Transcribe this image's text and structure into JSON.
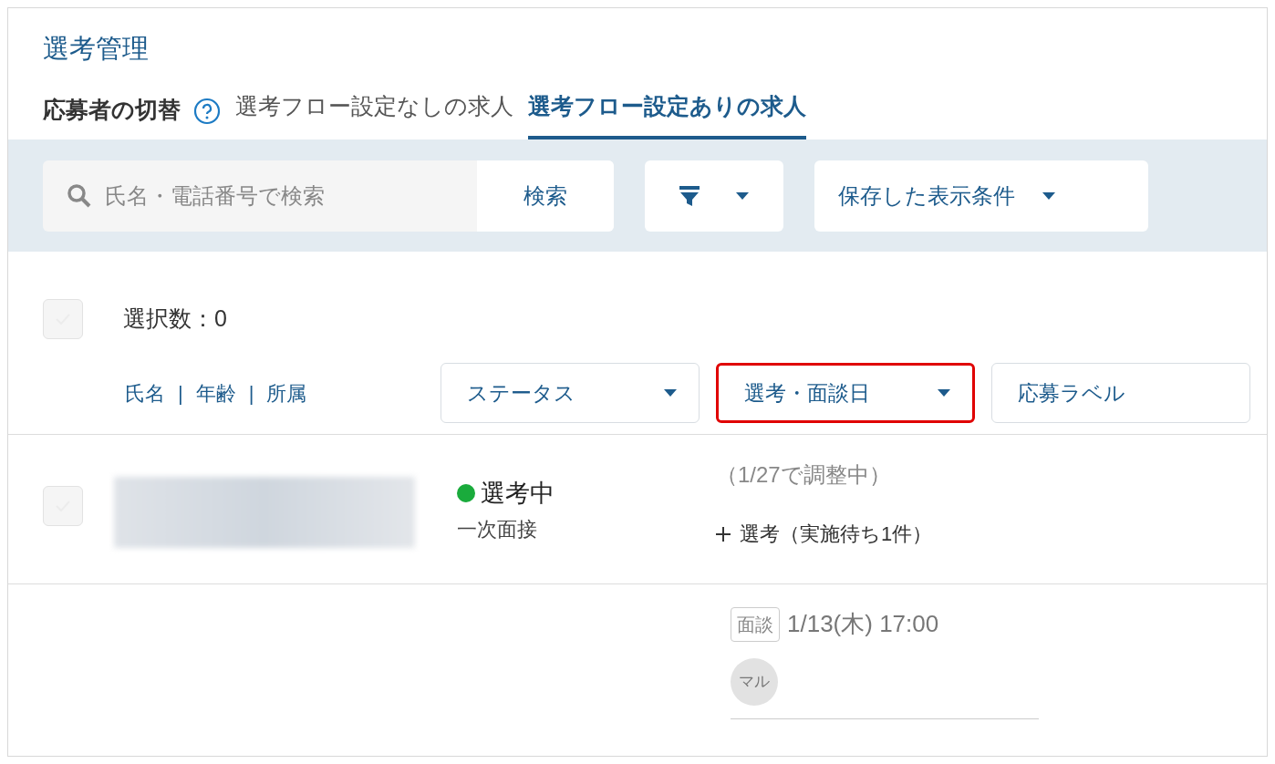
{
  "title": "選考管理",
  "switcher": {
    "label": "応募者の切替",
    "tabs": [
      {
        "label": "選考フロー設定なしの求人",
        "selected": false
      },
      {
        "label": "選考フロー設定ありの求人",
        "selected": true
      }
    ]
  },
  "search": {
    "placeholder": "氏名・電話番号で検索",
    "button": "検索"
  },
  "saved_conditions": {
    "label": "保存した表示条件"
  },
  "selection": {
    "checked": false,
    "disabled": true,
    "count_label": "選択数：0"
  },
  "columns": {
    "name_links": [
      "氏名",
      "年齢",
      "所属"
    ],
    "separator": "|",
    "dropdowns": [
      {
        "label": "ステータス",
        "highlighted": false
      },
      {
        "label": "選考・面談日",
        "highlighted": true
      },
      {
        "label": "応募ラベル",
        "highlighted": false
      }
    ]
  },
  "rows": [
    {
      "checked": false,
      "disabled": true,
      "status": {
        "label": "選考中",
        "color": "#1aab3c",
        "stage": "一次面接"
      },
      "schedule": {
        "note": "（1/27で調整中）",
        "add_label": "選考（実施待ち1件）"
      }
    },
    {
      "schedule": {
        "tag": "面談",
        "datetime": "1/13(木) 17:00",
        "avatar": "マル"
      }
    }
  ]
}
